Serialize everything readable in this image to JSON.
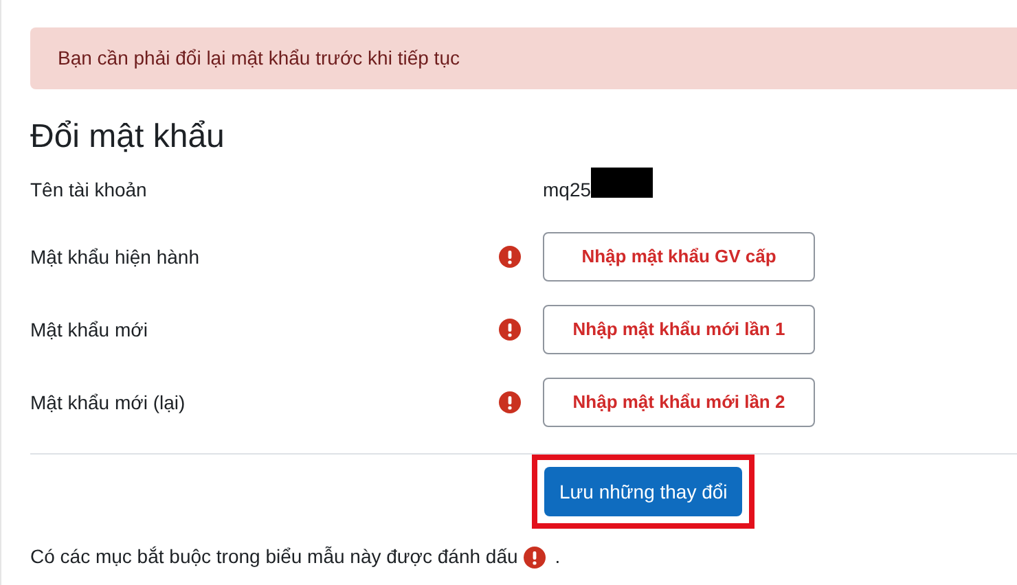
{
  "alert": "Bạn cần phải đổi lại mật khẩu trước khi tiếp tục",
  "heading": "Đổi mật khẩu",
  "username": {
    "label": "Tên tài khoản",
    "value": "mq25",
    "redacted": true
  },
  "fields": [
    {
      "label": "Mật khẩu hiện hành",
      "required": true,
      "value": "Nhập mật khẩu GV cấp"
    },
    {
      "label": "Mật khẩu mới",
      "required": true,
      "value": "Nhập mật khẩu mới lần 1"
    },
    {
      "label": "Mật khẩu mới (lại)",
      "required": true,
      "value": "Nhập mật khẩu mới lần 2"
    }
  ],
  "save_button": {
    "label": "Lưu những thay đổi",
    "highlighted": true
  },
  "footer": {
    "text": "Có các mục bắt buộc trong biểu mẫu này được đánh dấu",
    "suffix": "."
  }
}
